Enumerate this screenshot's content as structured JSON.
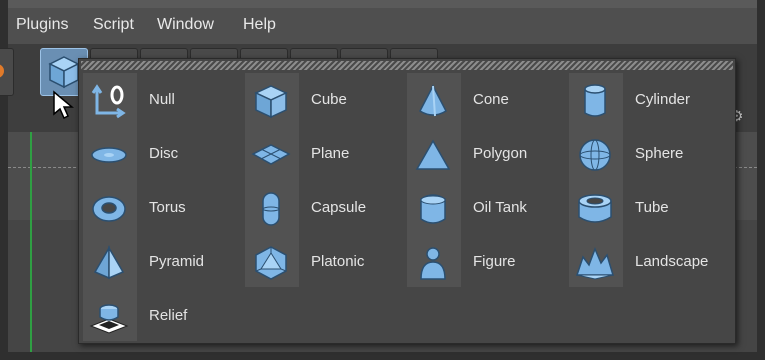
{
  "menubar": {
    "items": [
      {
        "label": "Plugins"
      },
      {
        "label": "Script"
      },
      {
        "label": "Window"
      },
      {
        "label": "Help"
      }
    ]
  },
  "toolbar": {
    "active_tool": "cube-icon"
  },
  "popup": {
    "columns": [
      [
        {
          "label": "Null",
          "icon": "null-icon"
        },
        {
          "label": "Disc",
          "icon": "disc-icon"
        },
        {
          "label": "Torus",
          "icon": "torus-icon"
        },
        {
          "label": "Pyramid",
          "icon": "pyramid-icon"
        },
        {
          "label": "Relief",
          "icon": "relief-icon"
        }
      ],
      [
        {
          "label": "Cube",
          "icon": "cube-icon"
        },
        {
          "label": "Plane",
          "icon": "plane-icon"
        },
        {
          "label": "Capsule",
          "icon": "capsule-icon"
        },
        {
          "label": "Platonic",
          "icon": "platonic-icon"
        }
      ],
      [
        {
          "label": "Cone",
          "icon": "cone-icon"
        },
        {
          "label": "Polygon",
          "icon": "polygon-icon"
        },
        {
          "label": "Oil Tank",
          "icon": "oil-tank-icon"
        },
        {
          "label": "Figure",
          "icon": "figure-icon"
        }
      ],
      [
        {
          "label": "Cylinder",
          "icon": "cylinder-icon"
        },
        {
          "label": "Sphere",
          "icon": "sphere-icon"
        },
        {
          "label": "Tube",
          "icon": "tube-icon"
        },
        {
          "label": "Landscape",
          "icon": "landscape-icon"
        }
      ]
    ]
  },
  "colors": {
    "icon_fill": "#7fb6e6",
    "icon_stroke": "#2b4f70",
    "text": "#e4e4e4"
  }
}
